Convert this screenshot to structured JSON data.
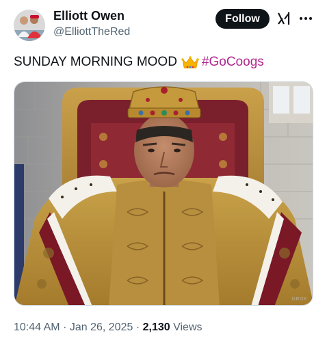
{
  "author": {
    "name": "Elliott Owen",
    "handle": "@ElliottTheRed",
    "avatar_icon": "user-avatar"
  },
  "actions": {
    "follow_label": "Follow",
    "grok_icon": "grok-icon",
    "more_icon": "more-options-icon"
  },
  "tweet": {
    "text": "SUNDAY MORNING MOOD",
    "emoji": "crown-emoji",
    "hashtag": "#GoCoogs",
    "hashtag_color": "#b0268f"
  },
  "media": {
    "watermark": "GROK"
  },
  "meta": {
    "time": "10:44 AM",
    "sep1": "·",
    "date": "Jan 26, 2025",
    "sep2": "·",
    "views_count": "2,130",
    "views_label": "Views"
  }
}
